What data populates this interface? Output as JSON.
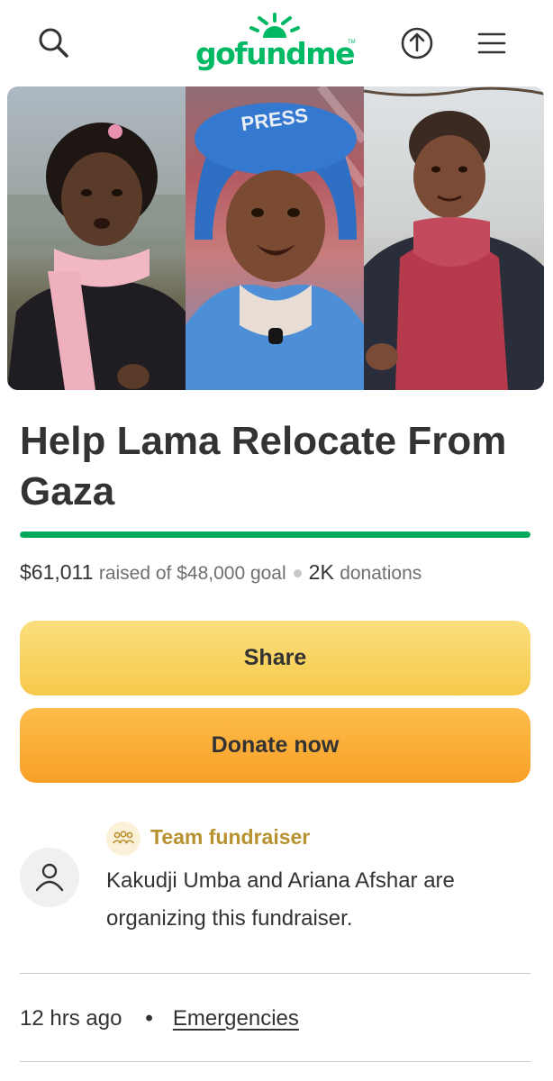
{
  "header": {
    "logo_text": "gofundme",
    "logo_tm": "TM",
    "icons": [
      "search-icon",
      "upload-icon",
      "hamburger-menu-icon"
    ],
    "brand_color": "#00b964"
  },
  "hero": {
    "panels": [
      "girl-pink-scarf-photo",
      "girl-press-helmet-photo",
      "girl-red-hoodie-photo"
    ],
    "helmet_text": "PRESS"
  },
  "campaign": {
    "title": "Help Lama Relocate From Gaza",
    "progress_fraction": 1.0,
    "progress_color": "#02a95c",
    "raised": "$61,011",
    "raised_of": "raised of $48,000 goal",
    "donations_count": "2K",
    "donations_label": "donations"
  },
  "actions": {
    "share_label": "Share",
    "donate_label": "Donate now"
  },
  "organizer": {
    "badge_icon": "team-people-icon",
    "badge_label": "Team fundraiser",
    "text": "Kakudji Umba and Ariana Afshar are organizing this fundraiser."
  },
  "meta": {
    "time_ago": "12 hrs ago",
    "separator": "•",
    "category": "Emergencies"
  }
}
